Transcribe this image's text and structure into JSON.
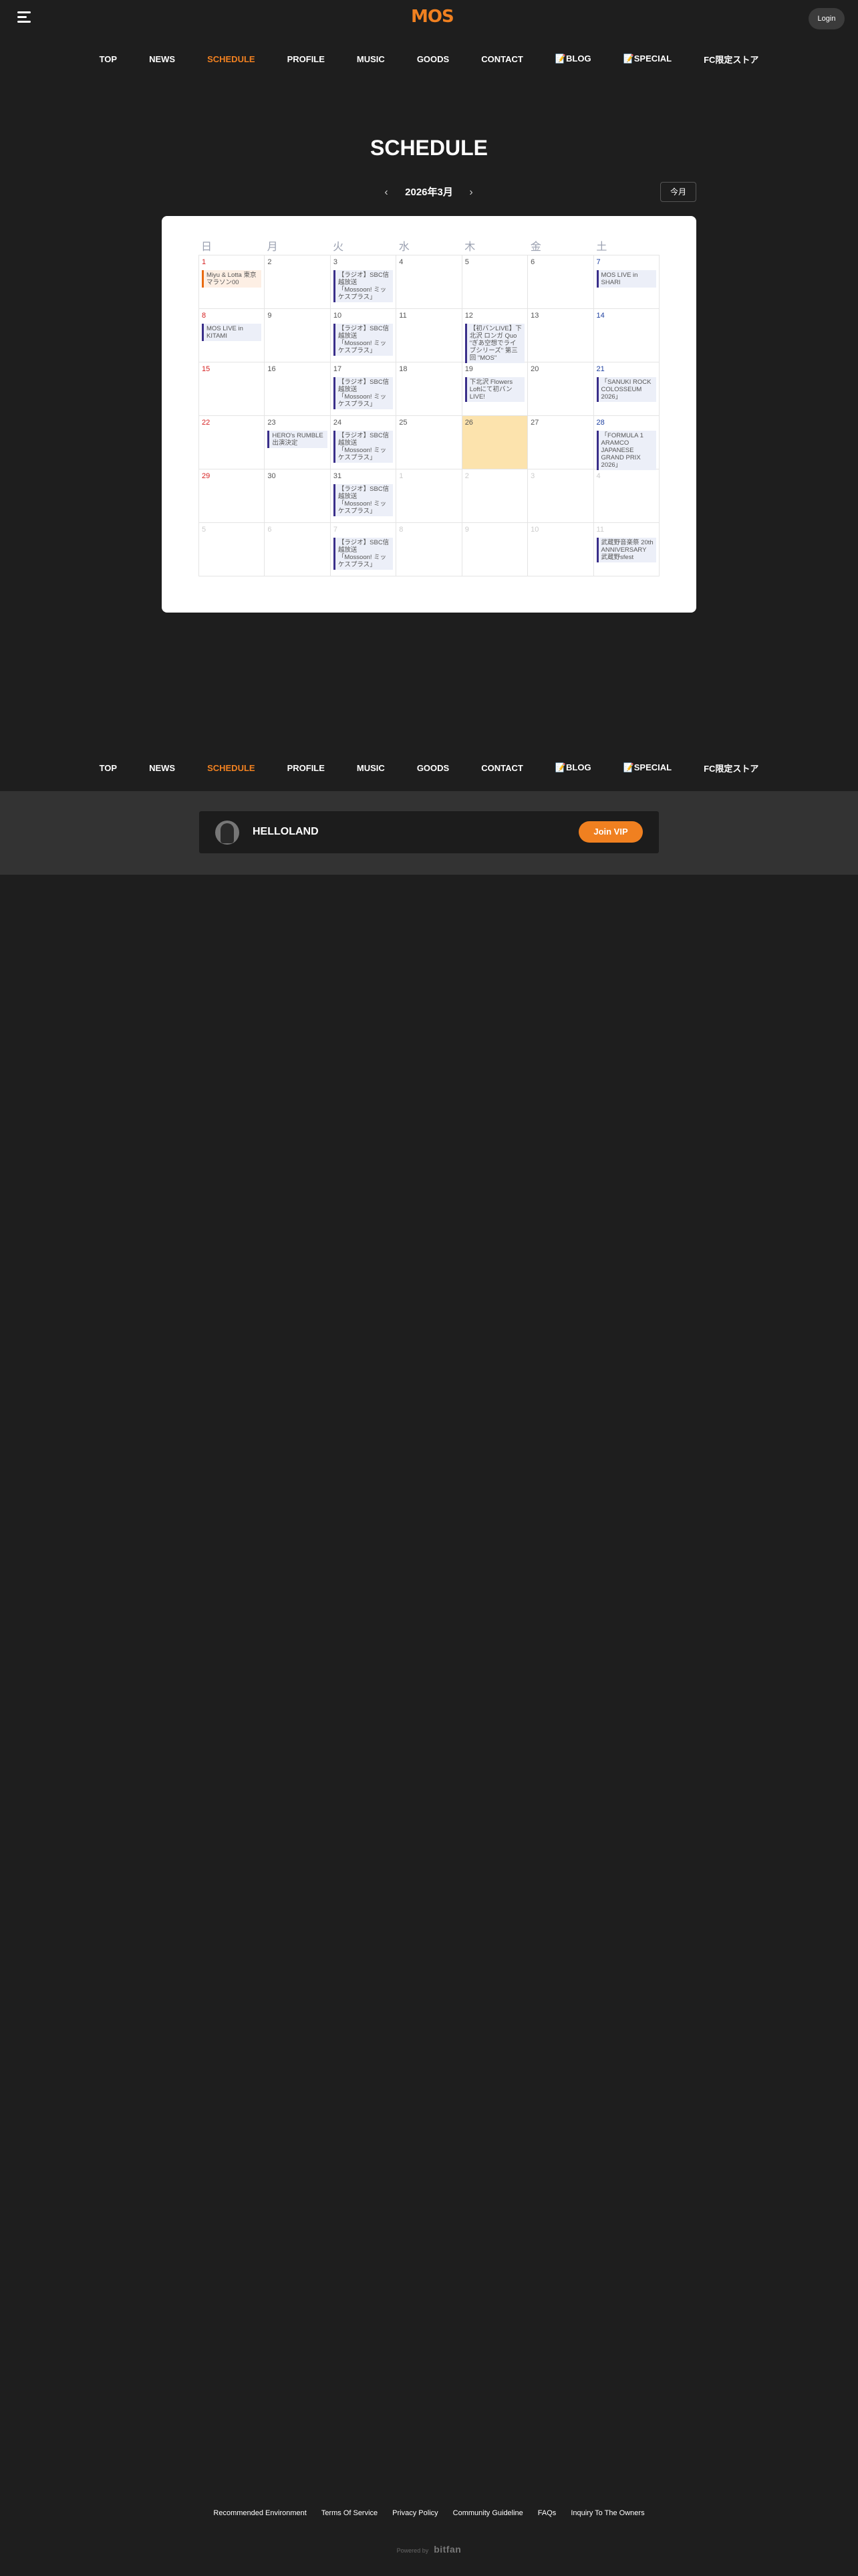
{
  "header": {
    "logo_text": "MOS",
    "login_label": "Login"
  },
  "nav": {
    "items": [
      "TOP",
      "NEWS",
      "SCHEDULE",
      "PROFILE",
      "MUSIC",
      "GOODS",
      "CONTACT",
      "📝BLOG",
      "📝SPECIAL",
      "FC限定ストア"
    ],
    "active": "SCHEDULE"
  },
  "page": {
    "title": "SCHEDULE"
  },
  "calendar": {
    "month_label": "2026年3月",
    "prev_label": "‹",
    "next_label": "›",
    "today_label": "今月",
    "weekdays": [
      "日",
      "月",
      "火",
      "水",
      "木",
      "金",
      "土"
    ],
    "weeks": [
      [
        {
          "d": "1",
          "events": [
            {
              "t": "Miyu & Lotta 東京マラソン00",
              "c": "orange"
            }
          ]
        },
        {
          "d": "2"
        },
        {
          "d": "3",
          "events": [
            {
              "t": "【ラジオ】SBC信越放送「Mossoon! ミッケスプラス」"
            }
          ]
        },
        {
          "d": "4"
        },
        {
          "d": "5"
        },
        {
          "d": "6"
        },
        {
          "d": "7",
          "events": [
            {
              "t": "MOS LIVE in SHARI"
            }
          ]
        }
      ],
      [
        {
          "d": "8",
          "events": [
            {
              "t": "MOS LIVE in KITAMI"
            }
          ]
        },
        {
          "d": "9"
        },
        {
          "d": "10",
          "events": [
            {
              "t": "【ラジオ】SBC信越放送「Mossoon! ミッケスプラス」"
            }
          ]
        },
        {
          "d": "11"
        },
        {
          "d": "12",
          "events": [
            {
              "t": "【初バンLIVE】下北沢 ロンガ Quo \"ぎあ空想でライブシリーズ\" 第三回 \"MOS\""
            }
          ]
        },
        {
          "d": "13"
        },
        {
          "d": "14"
        }
      ],
      [
        {
          "d": "15"
        },
        {
          "d": "16"
        },
        {
          "d": "17",
          "events": [
            {
              "t": "【ラジオ】SBC信越放送「Mossoon! ミッケスプラス」"
            }
          ]
        },
        {
          "d": "18"
        },
        {
          "d": "19",
          "events": [
            {
              "t": "下北沢 Flowers Loftにて初バンLIVE!"
            }
          ]
        },
        {
          "d": "20"
        },
        {
          "d": "21",
          "events": [
            {
              "t": "「SANUKI ROCK COLOSSEUM 2026」"
            }
          ]
        }
      ],
      [
        {
          "d": "22"
        },
        {
          "d": "23",
          "events": [
            {
              "t": "HERO's RUMBLE 出演決定"
            }
          ]
        },
        {
          "d": "24",
          "events": [
            {
              "t": "【ラジオ】SBC信越放送「Mossoon! ミッケスプラス」"
            }
          ]
        },
        {
          "d": "25"
        },
        {
          "d": "26",
          "today": true
        },
        {
          "d": "27"
        },
        {
          "d": "28",
          "events": [
            {
              "t": "「FORMULA 1 ARAMCO JAPANESE GRAND PRIX 2026」"
            }
          ]
        }
      ],
      [
        {
          "d": "29"
        },
        {
          "d": "30"
        },
        {
          "d": "31",
          "events": [
            {
              "t": "【ラジオ】SBC信越放送「Mossoon! ミッケスプラス」"
            }
          ]
        },
        {
          "d": "1",
          "other": true
        },
        {
          "d": "2",
          "other": true
        },
        {
          "d": "3",
          "other": true
        },
        {
          "d": "4",
          "other": true
        }
      ],
      [
        {
          "d": "5",
          "other": true
        },
        {
          "d": "6",
          "other": true
        },
        {
          "d": "7",
          "other": true,
          "events": [
            {
              "t": "【ラジオ】SBC信越放送「Mossoon! ミッケスプラス」"
            }
          ]
        },
        {
          "d": "8",
          "other": true
        },
        {
          "d": "9",
          "other": true
        },
        {
          "d": "10",
          "other": true
        },
        {
          "d": "11",
          "other": true,
          "events": [
            {
              "t": "武蔵野音楽祭 20th ANNIVERSARY 武蔵野sfest"
            }
          ]
        }
      ]
    ]
  },
  "vip": {
    "name": "HELLOLAND",
    "button_label": "Join VIP"
  },
  "footer": {
    "links": [
      "Recommended Environment",
      "Terms Of Service",
      "Privacy Policy",
      "Community Guideline",
      "FAQs",
      "Inquiry To The Owners"
    ],
    "powered_by": "Powered by",
    "brand": "bitfan"
  }
}
